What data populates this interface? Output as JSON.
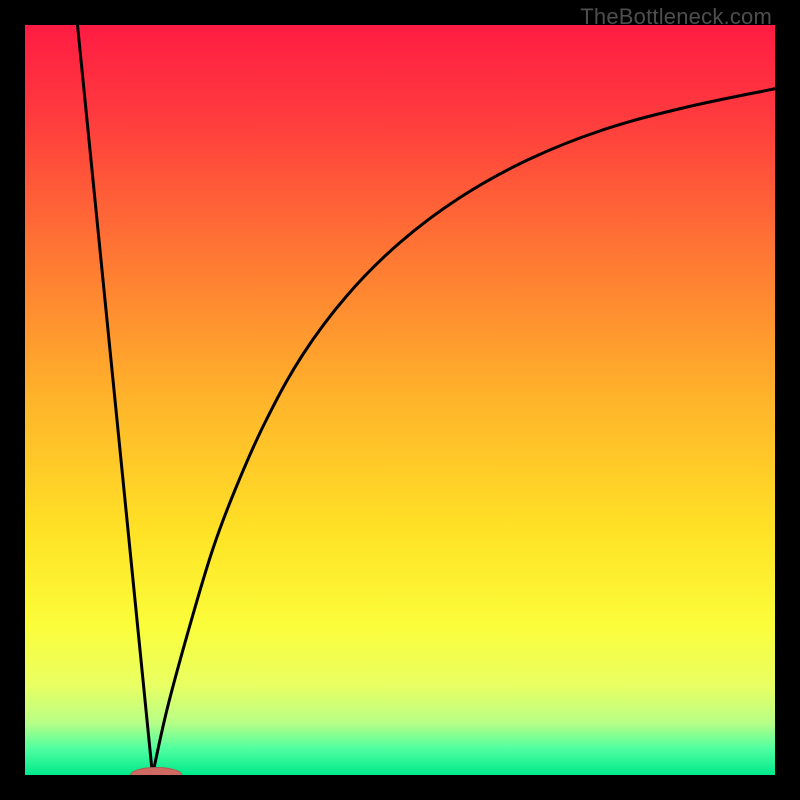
{
  "watermark": "TheBottleneck.com",
  "colors": {
    "frame": "#000000",
    "curve": "#000000",
    "marker_fill": "#cf6a63",
    "marker_stroke": "#b05850",
    "gradient_stops": [
      {
        "offset": 0.0,
        "color": "#ff1c43"
      },
      {
        "offset": 0.12,
        "color": "#ff3a3e"
      },
      {
        "offset": 0.3,
        "color": "#ff7534"
      },
      {
        "offset": 0.5,
        "color": "#ffb42a"
      },
      {
        "offset": 0.68,
        "color": "#ffe326"
      },
      {
        "offset": 0.8,
        "color": "#fbfd3a"
      },
      {
        "offset": 0.88,
        "color": "#e9ff62"
      },
      {
        "offset": 0.93,
        "color": "#b8ff86"
      },
      {
        "offset": 0.965,
        "color": "#4fffa0"
      },
      {
        "offset": 1.0,
        "color": "#00e98b"
      }
    ]
  },
  "chart_data": {
    "type": "line",
    "title": "",
    "xlabel": "",
    "ylabel": "",
    "xlim": [
      0,
      100
    ],
    "ylim": [
      0,
      100
    ],
    "optimum_x": 17,
    "series": [
      {
        "name": "left-falling",
        "x": [
          7,
          17
        ],
        "values": [
          100,
          0
        ]
      },
      {
        "name": "right-rising",
        "x": [
          17,
          19,
          22,
          25,
          28,
          32,
          37,
          43,
          50,
          58,
          67,
          77,
          88,
          100
        ],
        "values": [
          0,
          9,
          20,
          30,
          38,
          47,
          56,
          64,
          71,
          77,
          82,
          86,
          89,
          91.5
        ]
      }
    ],
    "marker": {
      "cx": 17.5,
      "cy": 0,
      "rx": 3.4,
      "ry": 1.0
    }
  }
}
